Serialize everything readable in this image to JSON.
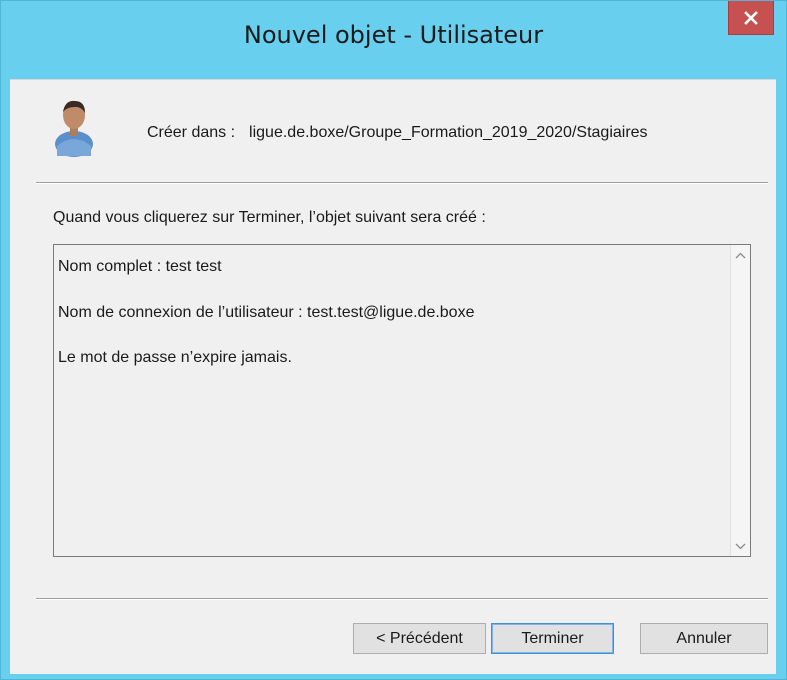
{
  "window": {
    "title": "Nouvel objet - Utilisateur",
    "close_icon": "close-icon"
  },
  "header": {
    "create_label": "Créer dans :",
    "create_path": "ligue.de.boxe/Groupe_Formation_2019_2020/Stagiaires",
    "icon": "user-icon"
  },
  "intro_text": "Quand vous cliquerez sur Terminer, l’objet suivant sera créé :",
  "summary": {
    "lines": [
      "Nom complet : test test",
      "Nom de connexion de l’utilisateur : test.test@ligue.de.boxe",
      "Le mot de passe n’expire jamais."
    ]
  },
  "buttons": {
    "previous": "< Précédent",
    "finish": "Terminer",
    "cancel": "Annuler"
  },
  "colors": {
    "title_bar": "#69cfee",
    "close_button": "#c75050",
    "client_background": "#f0f0f0"
  }
}
